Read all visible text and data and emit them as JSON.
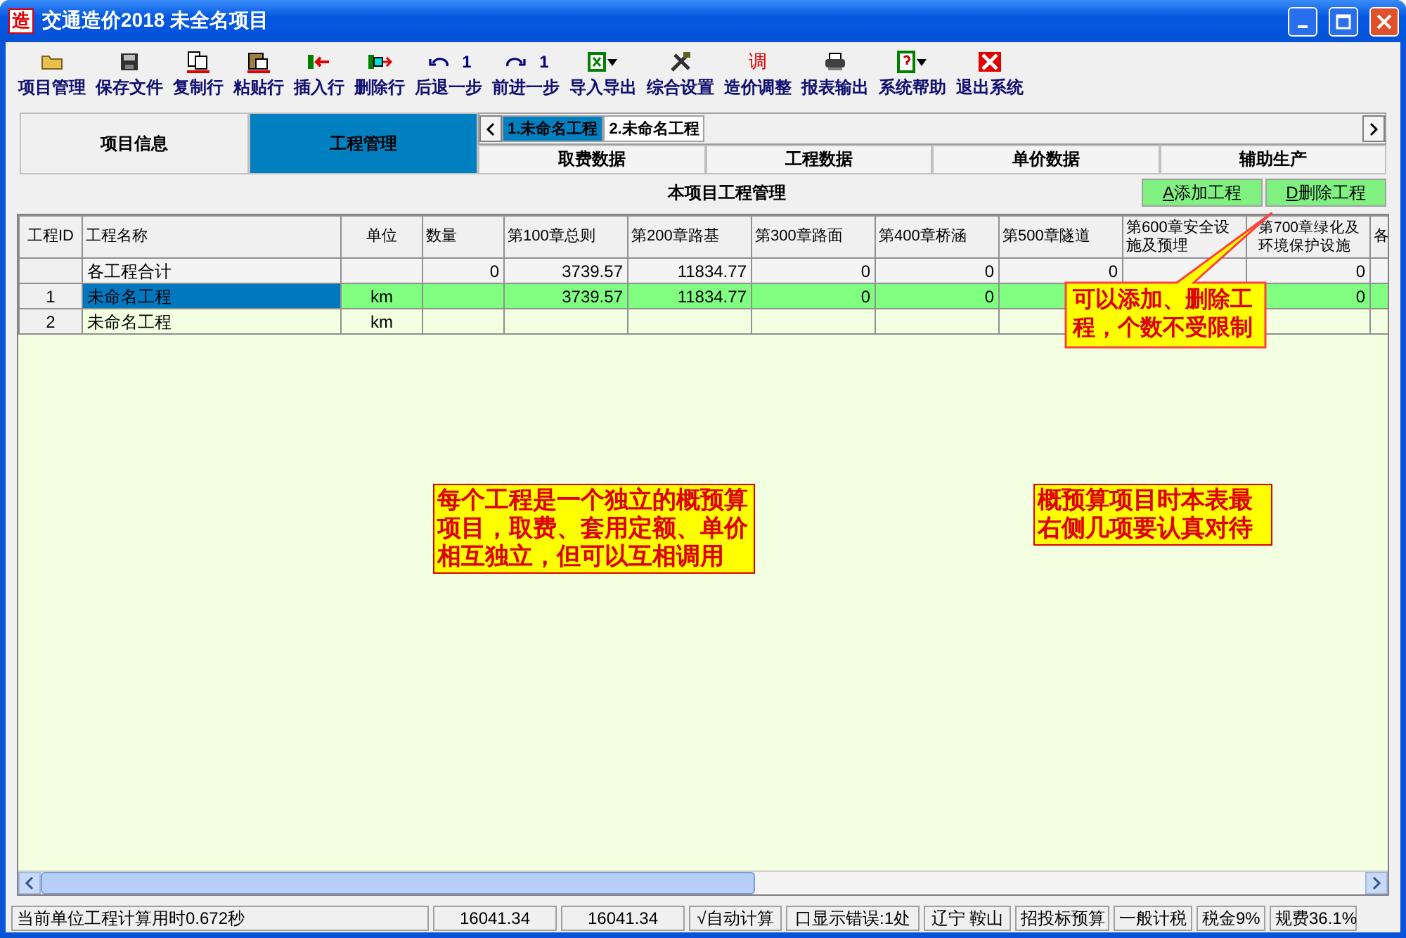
{
  "window": {
    "icon_text": "造",
    "title": "交通造价2018 未全名项目"
  },
  "toolbar": [
    {
      "kind": "folder",
      "label": "项目管理"
    },
    {
      "kind": "save",
      "label": "保存文件"
    },
    {
      "kind": "copy",
      "label": "复制行"
    },
    {
      "kind": "paste",
      "label": "粘贴行"
    },
    {
      "kind": "insert",
      "label": "插入行"
    },
    {
      "kind": "remove",
      "label": "删除行"
    },
    {
      "kind": "undo",
      "label": "后退一步",
      "count": "1"
    },
    {
      "kind": "redo",
      "label": "前进一步",
      "count": "1"
    },
    {
      "kind": "sheet",
      "label": "导入导出"
    },
    {
      "kind": "tools",
      "label": "综合设置"
    },
    {
      "kind": "glyph",
      "label": "造价调整",
      "glyph": "调"
    },
    {
      "kind": "printer",
      "label": "报表输出"
    },
    {
      "kind": "help",
      "label": "系统帮助"
    },
    {
      "kind": "exit",
      "label": "退出系统"
    }
  ],
  "main_tabs": [
    {
      "label": "项目信息",
      "selected": false
    },
    {
      "label": "工程管理",
      "selected": true
    }
  ],
  "project_tabs": [
    {
      "label": "1.未命名工程",
      "selected": true
    },
    {
      "label": "2.未命名工程",
      "selected": false
    }
  ],
  "sub_tabs": [
    {
      "label": "取费数据",
      "selected": false
    },
    {
      "label": "工程数据",
      "selected": false
    },
    {
      "label": "单价数据",
      "selected": false
    },
    {
      "label": "辅助生产",
      "selected": false
    }
  ],
  "section": {
    "title": "本项目工程管理",
    "buttons": [
      {
        "accel": "A",
        "label": "添加工程"
      },
      {
        "accel": "D",
        "label": "删除工程"
      }
    ]
  },
  "table": {
    "columns": [
      "工程ID",
      "工程名称",
      "单位",
      "数量",
      "第100章总则",
      "第200章路基",
      "第300章路面",
      "第400章桥涵",
      "第500章隧道",
      "第600章安全设施及预埋",
      "第700章绿化及环境保护设施",
      "各"
    ],
    "rows": [
      {
        "kind": "total",
        "selected": false,
        "cells": [
          null,
          "各工程合计",
          null,
          "0",
          "3739.57",
          "11834.77",
          "0",
          "0",
          "0",
          null,
          "0",
          null
        ]
      },
      {
        "kind": "item",
        "selected": true,
        "cells": [
          "1",
          "未命名工程",
          "km",
          null,
          "3739.57",
          "11834.77",
          "0",
          "0",
          null,
          null,
          "0",
          null
        ]
      },
      {
        "kind": "item",
        "selected": false,
        "cells": [
          "2",
          "未命名工程",
          "km",
          null,
          null,
          null,
          null,
          null,
          null,
          null,
          null,
          null
        ]
      }
    ]
  },
  "notes": [
    {
      "kind": "callout",
      "text": "可以添加、删除工程，个数不受限制"
    },
    {
      "kind": "box",
      "text": "每个工程是一个独立的概预算项目，取费、套用定额、单价相互独立，但可以互相调用"
    },
    {
      "kind": "box",
      "text": "概预算项目时本表最右侧几项要认真对待"
    }
  ],
  "status_bar": [
    "当前单位工程计算用时0.672秒",
    "16041.34",
    "16041.34",
    "√自动计算",
    "口显示错误:1处",
    "辽宁 鞍山",
    "招投标预算",
    "一般计税",
    "税金9%",
    "规费36.1%"
  ]
}
